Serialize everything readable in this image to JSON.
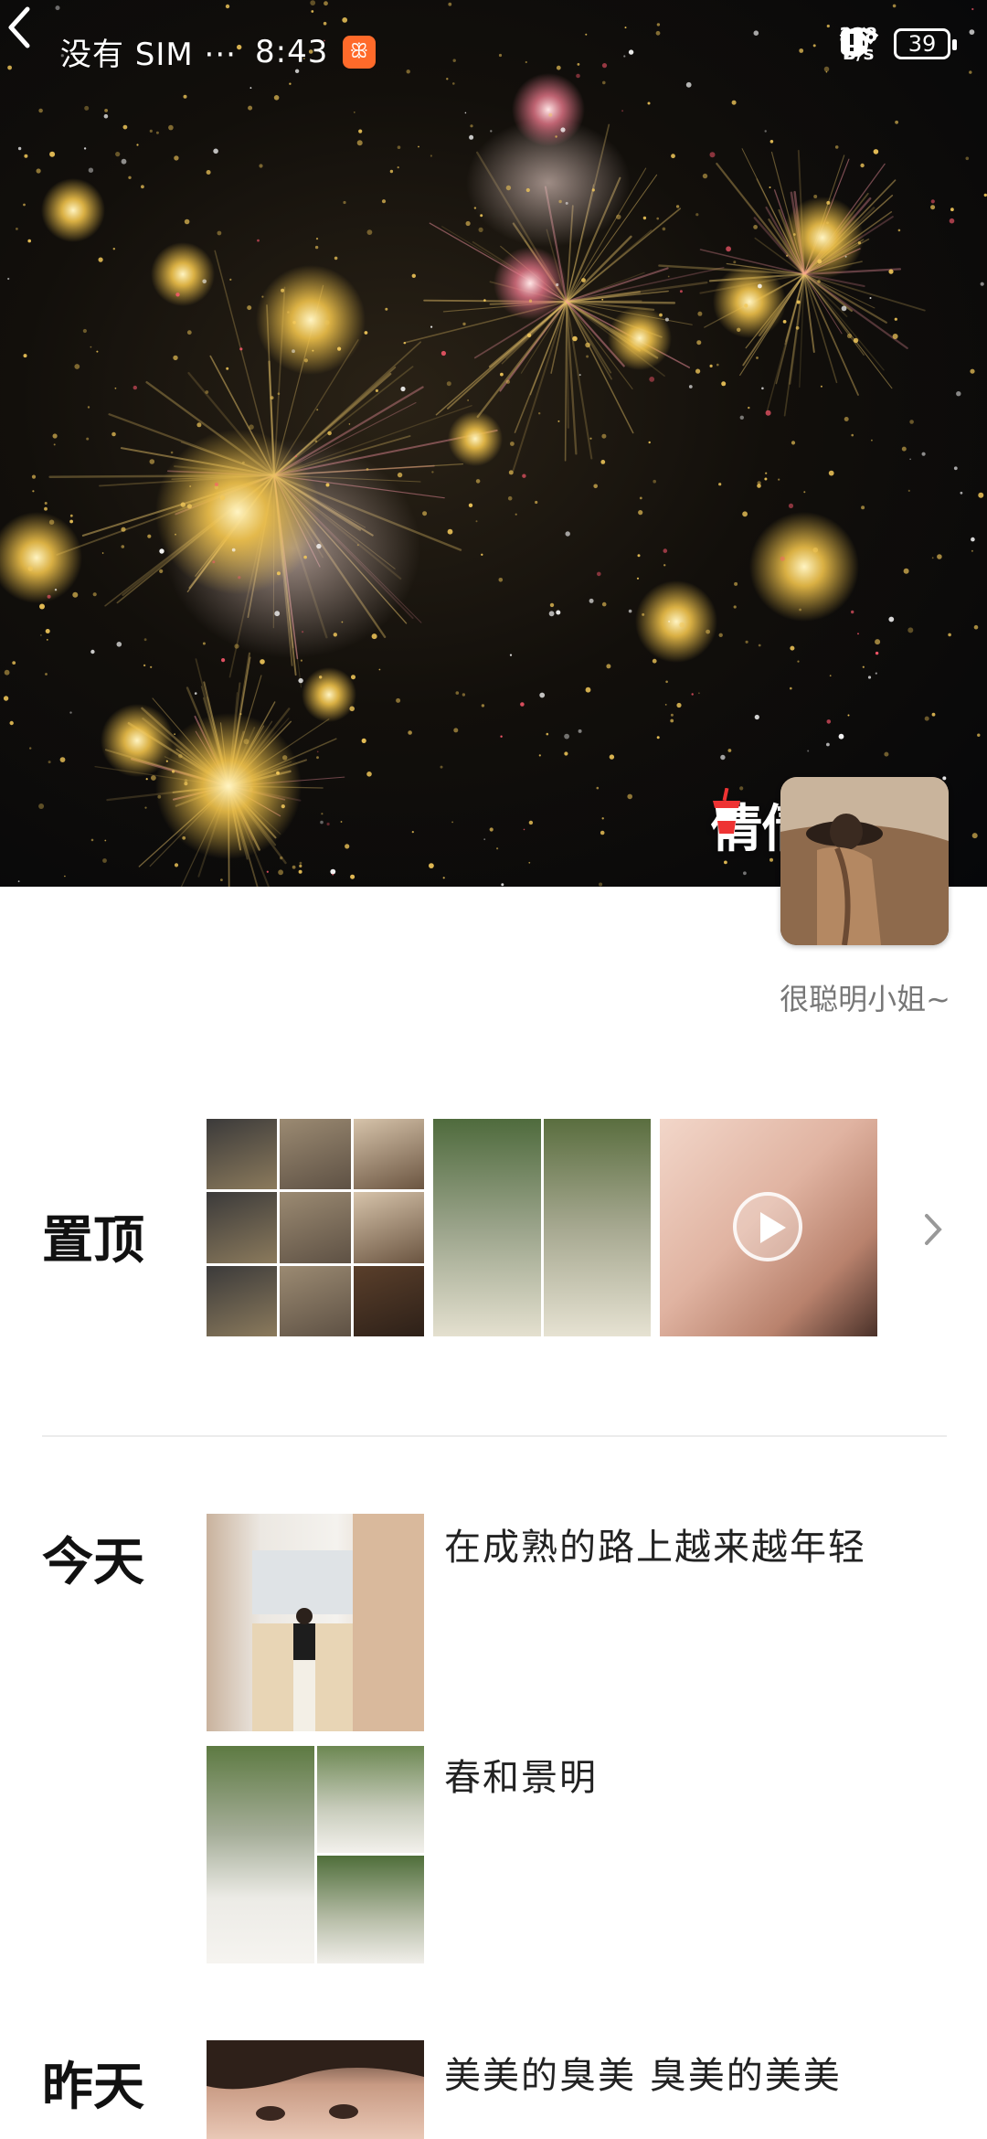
{
  "status_bar": {
    "carrier": "没有 SIM ···",
    "time": "8:43",
    "net_speed_value": "328",
    "net_speed_unit": "B/s",
    "battery": "39"
  },
  "profile": {
    "name": "倩倩",
    "signature": "很聪明小姐~"
  },
  "sections": {
    "pinned": {
      "label": "置顶"
    },
    "today": {
      "label": "今天",
      "posts": [
        {
          "text": "在成熟的路上越来越年轻"
        },
        {
          "text": "春和景明"
        }
      ]
    },
    "yesterday": {
      "label": "昨天",
      "posts": [
        {
          "text": "美美的臭美  臭美的美美"
        }
      ]
    }
  },
  "colors": {
    "accent_badge": "#ff6a2a",
    "cover_bg": "#06070a"
  }
}
